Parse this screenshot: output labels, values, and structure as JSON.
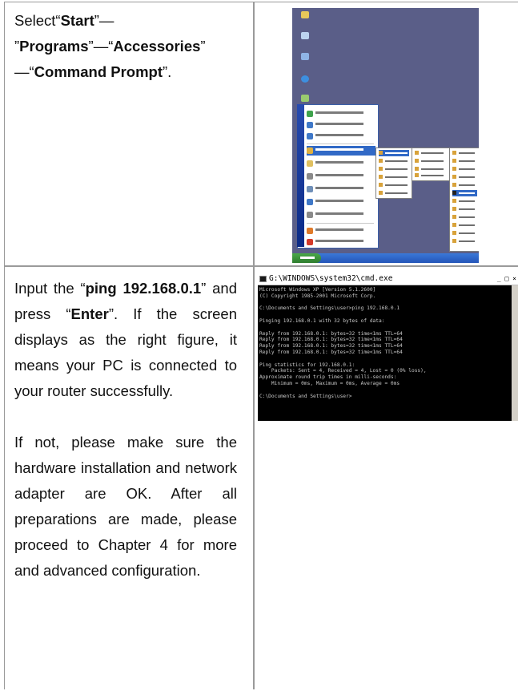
{
  "row1": {
    "instruction": {
      "p1": "Select“",
      "start": "Start",
      "p2": "”— ”",
      "programs": "Programs",
      "p3": "”—“",
      "accessories": "Accessories",
      "p4": "” —“",
      "command_prompt": "Command Prompt",
      "p5": "”."
    }
  },
  "row2": {
    "para1": {
      "p1": "Input the “",
      "cmd": "ping 192.168.0.1",
      "p2": "” and press “",
      "enter": "Enter",
      "p3": "”. If the screen displays as the right figure, it means your PC is connected to your router successfully."
    },
    "para2": "If not, please make sure the hardware installation and network adapter are OK. After all preparations are made, please proceed to Chapter 4 for more and advanced configuration."
  },
  "cmd_window": {
    "title": "G:\\WINDOWS\\system32\\cmd.exe",
    "controls": "_ □ ×",
    "lines": [
      "Microsoft Windows XP [Version 5.1.2600]",
      "(C) Copyright 1985-2001 Microsoft Corp.",
      "",
      "C:\\Documents and Settings\\user>ping 192.168.0.1",
      "",
      "Pinging 192.168.0.1 with 32 bytes of data:",
      "",
      "Reply from 192.168.0.1: bytes=32 time<1ms TTL=64",
      "Reply from 192.168.0.1: bytes=32 time<1ms TTL=64",
      "Reply from 192.168.0.1: bytes=32 time<1ms TTL=64",
      "Reply from 192.168.0.1: bytes=32 time<1ms TTL=64",
      "",
      "Ping statistics for 192.168.0.1:",
      "    Packets: Sent = 4, Received = 4, Lost = 0 (0% loss),",
      "Approximate round trip times in milli-seconds:",
      "    Minimum = 0ms, Maximum = 0ms, Average = 0ms",
      "",
      "C:\\Documents and Settings\\user>"
    ]
  },
  "desktop_screenshot": {
    "background_color": "#5a5e88",
    "start_menu_band_color": "#1f3f9e"
  }
}
